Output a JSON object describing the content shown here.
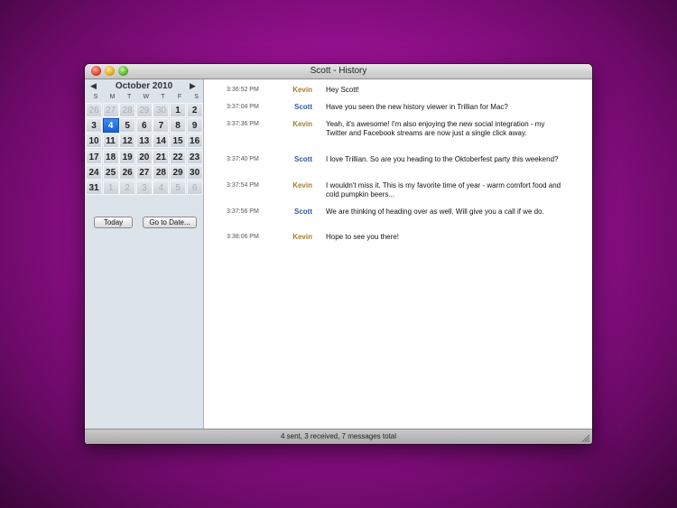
{
  "window": {
    "title": "Scott - History"
  },
  "calendar": {
    "month": "October 2010",
    "prev_icon": "chevron-left-icon",
    "next_icon": "chevron-right-icon",
    "weekdays": [
      "S",
      "M",
      "T",
      "W",
      "T",
      "F",
      "S"
    ],
    "weeks": [
      [
        {
          "d": "26",
          "o": true
        },
        {
          "d": "27",
          "o": true
        },
        {
          "d": "28",
          "o": true
        },
        {
          "d": "29",
          "o": true
        },
        {
          "d": "30",
          "o": true
        },
        {
          "d": "1"
        },
        {
          "d": "2"
        }
      ],
      [
        {
          "d": "3"
        },
        {
          "d": "4",
          "sel": true
        },
        {
          "d": "5"
        },
        {
          "d": "6"
        },
        {
          "d": "7"
        },
        {
          "d": "8"
        },
        {
          "d": "9"
        }
      ],
      [
        {
          "d": "10"
        },
        {
          "d": "11"
        },
        {
          "d": "12"
        },
        {
          "d": "13"
        },
        {
          "d": "14"
        },
        {
          "d": "15"
        },
        {
          "d": "16"
        }
      ],
      [
        {
          "d": "17"
        },
        {
          "d": "18"
        },
        {
          "d": "19"
        },
        {
          "d": "20"
        },
        {
          "d": "21"
        },
        {
          "d": "22"
        },
        {
          "d": "23"
        }
      ],
      [
        {
          "d": "24"
        },
        {
          "d": "25"
        },
        {
          "d": "26"
        },
        {
          "d": "27"
        },
        {
          "d": "28"
        },
        {
          "d": "29"
        },
        {
          "d": "30"
        }
      ],
      [
        {
          "d": "31"
        },
        {
          "d": "1",
          "o": true
        },
        {
          "d": "2",
          "o": true
        },
        {
          "d": "3",
          "o": true
        },
        {
          "d": "4",
          "o": true
        },
        {
          "d": "5",
          "o": true
        },
        {
          "d": "6",
          "o": true
        }
      ]
    ],
    "today_label": "Today",
    "goto_label": "Go to Date..."
  },
  "colors": {
    "kevin": "#a67c2d",
    "scott": "#2f5d9c",
    "selected_day": "#1e6ee8"
  },
  "messages": [
    {
      "time": "3:36:52 PM",
      "sender": "Kevin",
      "text": "Hey Scott!"
    },
    {
      "time": "3:37:04 PM",
      "sender": "Scott",
      "text": "Have you seen the new history viewer in Trillian for Mac?"
    },
    {
      "time": "3:37:36 PM",
      "sender": "Kevin",
      "text": "Yeah, it's awesome! I'm also enjoying the new social integration - my Twitter and Facebook streams are now just a single click away."
    },
    {
      "time": "3:37:40 PM",
      "sender": "Scott",
      "text": "I love Trillian. So are you heading to the Oktoberfest party this weekend?"
    },
    {
      "time": "3:37:54 PM",
      "sender": "Kevin",
      "text": "I wouldn't miss it. This is my favorite time of year - warm comfort food and cold pumpkin beers..."
    },
    {
      "time": "3:37:56 PM",
      "sender": "Scott",
      "text": "We are thinking of heading over as well. Will give you a call if we do."
    },
    {
      "time": "3:38:06 PM",
      "sender": "Kevin",
      "text": "Hope to see you there!"
    }
  ],
  "status": {
    "summary": "4 sent, 3 received, 7 messages total"
  }
}
